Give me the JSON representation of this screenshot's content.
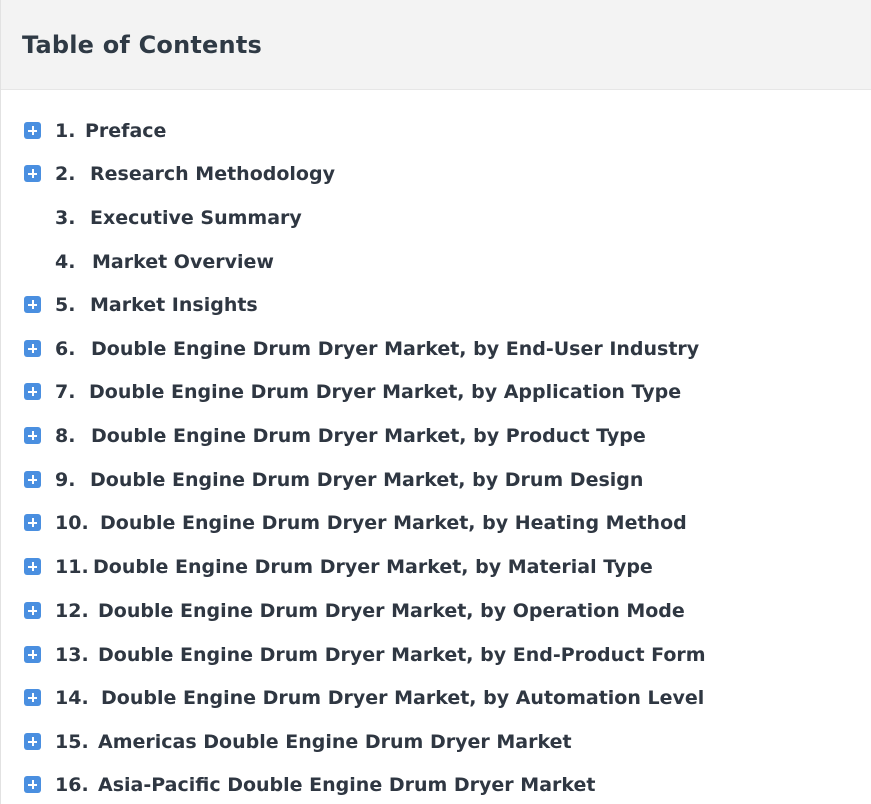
{
  "header": {
    "title": "Table of Contents"
  },
  "toc": {
    "items": [
      {
        "number": "1.",
        "label": "Preface",
        "expandable": true
      },
      {
        "number": "2.",
        "label": "Research Methodology",
        "expandable": true
      },
      {
        "number": "3.",
        "label": "Executive Summary",
        "expandable": false
      },
      {
        "number": "4.",
        "label": "Market Overview",
        "expandable": false
      },
      {
        "number": "5.",
        "label": "Market Insights",
        "expandable": true
      },
      {
        "number": "6.",
        "label": "Double Engine Drum Dryer Market, by End-User Industry",
        "expandable": true
      },
      {
        "number": "7.",
        "label": "Double Engine Drum Dryer Market, by Application Type",
        "expandable": true
      },
      {
        "number": "8.",
        "label": "Double Engine Drum Dryer Market, by Product Type",
        "expandable": true
      },
      {
        "number": "9.",
        "label": "Double Engine Drum Dryer Market, by Drum Design",
        "expandable": true
      },
      {
        "number": "10.",
        "label": "Double Engine Drum Dryer Market, by Heating Method",
        "expandable": true
      },
      {
        "number": "11.",
        "label": "Double Engine Drum Dryer Market, by Material Type",
        "expandable": true
      },
      {
        "number": "12.",
        "label": "Double Engine Drum Dryer Market, by Operation Mode",
        "expandable": true
      },
      {
        "number": "13.",
        "label": "Double Engine Drum Dryer Market, by End-Product Form",
        "expandable": true
      },
      {
        "number": "14.",
        "label": "Double Engine Drum Dryer Market, by Automation Level",
        "expandable": true
      },
      {
        "number": "15.",
        "label": "Americas Double Engine Drum Dryer Market",
        "expandable": true
      },
      {
        "number": "16.",
        "label": "Asia-Pacific Double Engine Drum Dryer Market",
        "expandable": true
      }
    ]
  },
  "colors": {
    "expand_button": "#4a8fe0",
    "header_bg": "#f3f3f3",
    "text": "#2f3742"
  },
  "icons": {
    "expand": "plus-square-icon"
  }
}
